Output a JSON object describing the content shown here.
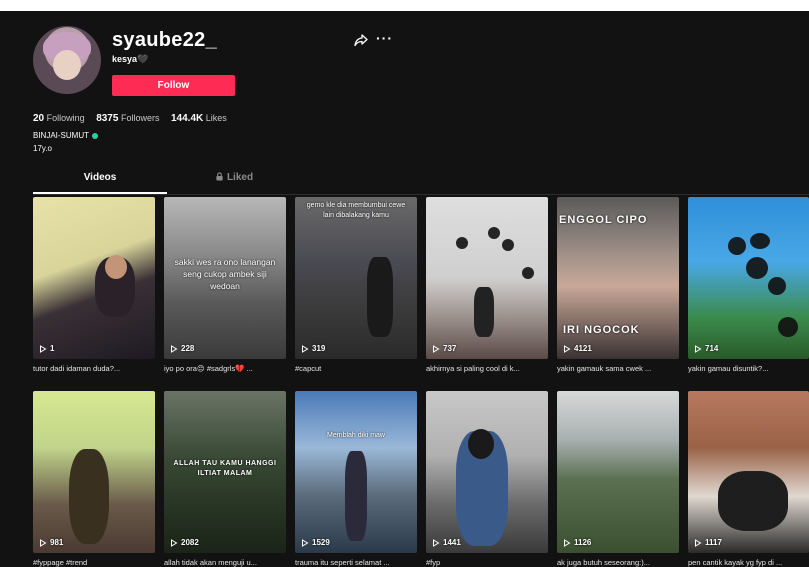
{
  "profile": {
    "username": "syaube22_",
    "nickname": "kesya🖤",
    "follow_label": "Follow",
    "stats": {
      "following_count": "20",
      "following_label": "Following",
      "followers_count": "8375",
      "followers_label": "Followers",
      "likes_count": "144.4K",
      "likes_label": "Likes"
    },
    "bio_line1": "BINJAI-SUMUT",
    "bio_line2": "17y.o"
  },
  "tabs": {
    "videos": "Videos",
    "liked": "Liked"
  },
  "videos": [
    {
      "views": "1",
      "caption": "tutor dadi idaman duda?..."
    },
    {
      "views": "228",
      "caption": "iyo po ora😔 #sadgrls💔 ...",
      "overlay": "sakki wes ra ono lanangan seng cukop ambek siji wedoan"
    },
    {
      "views": "319",
      "caption": "#capcut",
      "overlay": "gemo kle dia membumbui cewe lain dibalakang kamu"
    },
    {
      "views": "737",
      "caption": "akhirnya si paling cool di k..."
    },
    {
      "views": "4121",
      "caption": "yakin gamauk sama cwek ...",
      "overlay": "ENGGOL CIPO",
      "overlay2": "IRI NGOCOK"
    },
    {
      "views": "714",
      "caption": "yakin gamau disuntik?..."
    },
    {
      "views": "981",
      "caption": "#fyppage #trend"
    },
    {
      "views": "2082",
      "caption": "allah tidak akan menguji u...",
      "overlay": "ALLAH TAU KAMU HANGGI ILTIAT MALAM"
    },
    {
      "views": "1529",
      "caption": "trauma itu seperti selamat ...",
      "overlay": "Memblah diki maw"
    },
    {
      "views": "1441",
      "caption": "#fyp"
    },
    {
      "views": "1126",
      "caption": "ak juga butuh seseorang:)..."
    },
    {
      "views": "1117",
      "caption": "pen cantik kayak yg fyp di ..."
    }
  ],
  "colors": {
    "background": "#121212",
    "accent": "#fe2c55",
    "verified_dot": "#20d5a0"
  }
}
